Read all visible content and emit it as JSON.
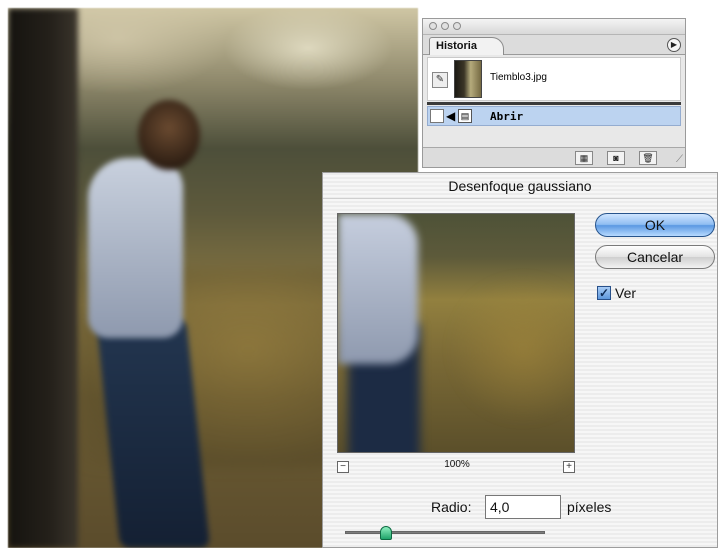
{
  "history_palette": {
    "tab_label": "Historia",
    "menu_icon": "triangle-right-icon",
    "snapshot": {
      "name": "Tiemblo3.jpg"
    },
    "states": [
      {
        "name": "Abrir",
        "selected": true
      }
    ],
    "footer_icons": [
      "new-document-from-state-icon",
      "camera-snapshot-icon",
      "trash-icon"
    ]
  },
  "dialog": {
    "title": "Desenfoque gaussiano",
    "ok_label": "OK",
    "cancel_label": "Cancelar",
    "preview_checkbox_label": "Ver",
    "preview_checked": true,
    "zoom_level": "100%",
    "zoom_out_symbol": "−",
    "zoom_in_symbol": "+",
    "radius_label": "Radio:",
    "radius_value": "4,0",
    "radius_units": "píxeles"
  },
  "colors": {
    "default_button": "#5a98e2",
    "selected_row": "#bcd3f0"
  }
}
